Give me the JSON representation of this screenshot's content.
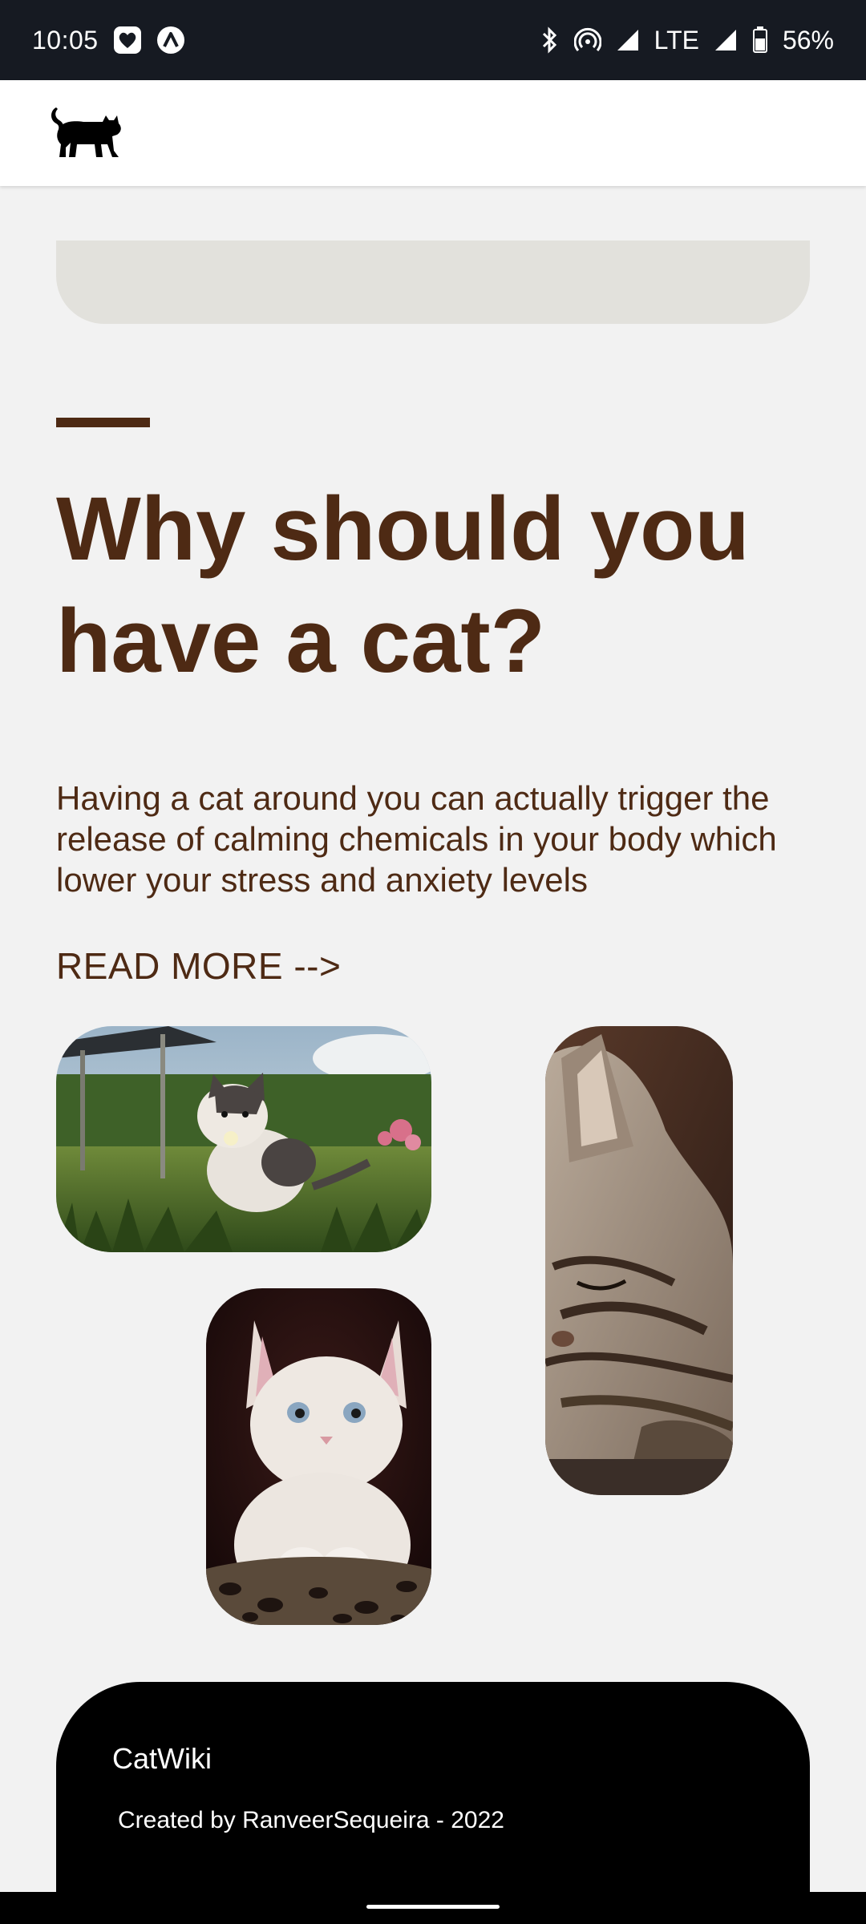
{
  "status_bar": {
    "time": "10:05",
    "network": "LTE",
    "battery": "56%",
    "icons": [
      "heart-app-icon",
      "alert-app-icon",
      "bluetooth-icon",
      "hotspot-icon",
      "signal-icon",
      "signal-icon",
      "battery-icon"
    ]
  },
  "app_bar": {
    "logo": "cat-logo-icon"
  },
  "hero": {
    "headline_line1": "Why should you",
    "headline_line2": "have a cat?",
    "body": "Having a cat around you can actually trigger the release of calming chemicals in your body which lower your stress and anxiety levels",
    "read_more": "READ MORE -->"
  },
  "photos": [
    {
      "name": "kitten-in-grass-photo"
    },
    {
      "name": "sleeping-tabby-photo"
    },
    {
      "name": "white-kitten-photo"
    }
  ],
  "footer": {
    "title": "CatWiki",
    "credit": "Created by RanveerSequeira - 2022"
  },
  "colors": {
    "brand_brown": "#4e2a14",
    "background": "#f2f2f2",
    "search_bg": "#e2e1dc",
    "status_bar": "#161a22",
    "footer": "#000000"
  }
}
